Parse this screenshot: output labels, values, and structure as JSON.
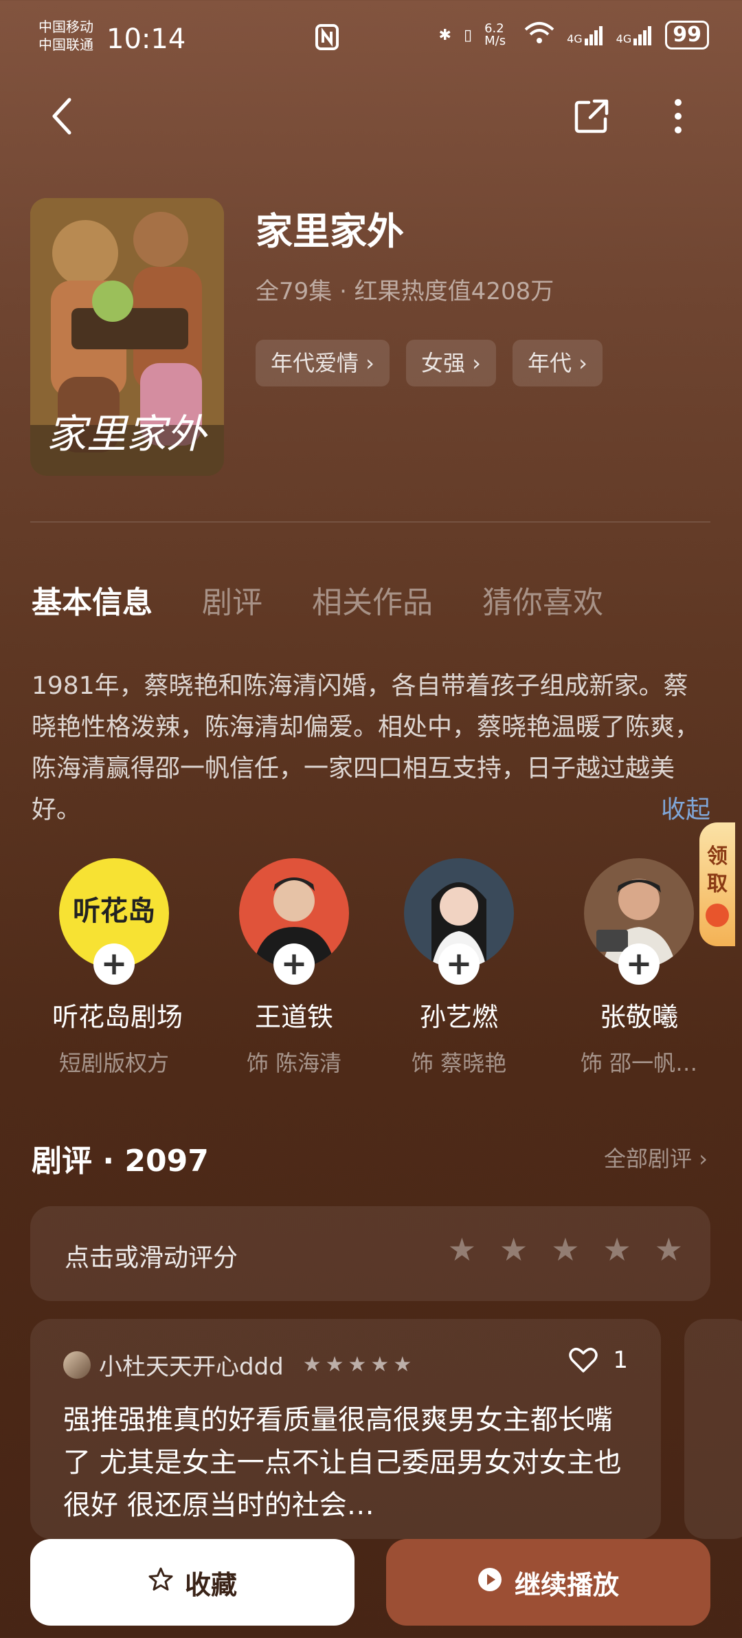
{
  "status_bar": {
    "carrier1": "中国移动",
    "carrier2": "中国联通",
    "time": "10:14",
    "speed": "6.2 M/s",
    "net1": "4G",
    "net2": "4G",
    "battery": "99"
  },
  "header": {
    "back_icon": "back-arrow-icon",
    "share_icon": "share-icon",
    "more_icon": "more-vertical-icon"
  },
  "show": {
    "title": "家里家外",
    "meta": "全79集 · 红果热度值4208万",
    "poster_title": "家里家外",
    "tags": [
      "年代爱情 ›",
      "女强 ›",
      "年代 ›"
    ]
  },
  "tabs": [
    "基本信息",
    "剧评",
    "相关作品",
    "猜你喜欢"
  ],
  "description": "1981年，蔡晓艳和陈海清闪婚，各自带着孩子组成新家。蔡晓艳性格泼辣，陈海清却偏爱。相处中，蔡晓艳温暖了陈爽，陈海清赢得邵一帆信任，一家四口相互支持，日子越过越美好。",
  "collapse_label": "收起",
  "side_badge": "领取",
  "cast": [
    {
      "name": "听花岛剧场",
      "role": "短剧版权方",
      "logo_text": "听花岛"
    },
    {
      "name": "王道铁",
      "role": "饰 陈海清"
    },
    {
      "name": "孙艺燃",
      "role": "饰 蔡晓艳"
    },
    {
      "name": "张敬曦",
      "role": "饰 邵一帆…"
    }
  ],
  "reviews_section": {
    "title": "剧评 · 2097",
    "all_label": "全部剧评 ›",
    "rate_label": "点击或滑动评分"
  },
  "review": {
    "user": "小杜天天开心ddd",
    "likes": "1",
    "rating": 5,
    "text": "强推强推真的好看质量很高很爽男女主都长嘴了 尤其是女主一点不让自己委屈男女对女主也很好 很还原当时的社会…"
  },
  "buttons": {
    "favorite": "收藏",
    "play": "继续播放"
  }
}
